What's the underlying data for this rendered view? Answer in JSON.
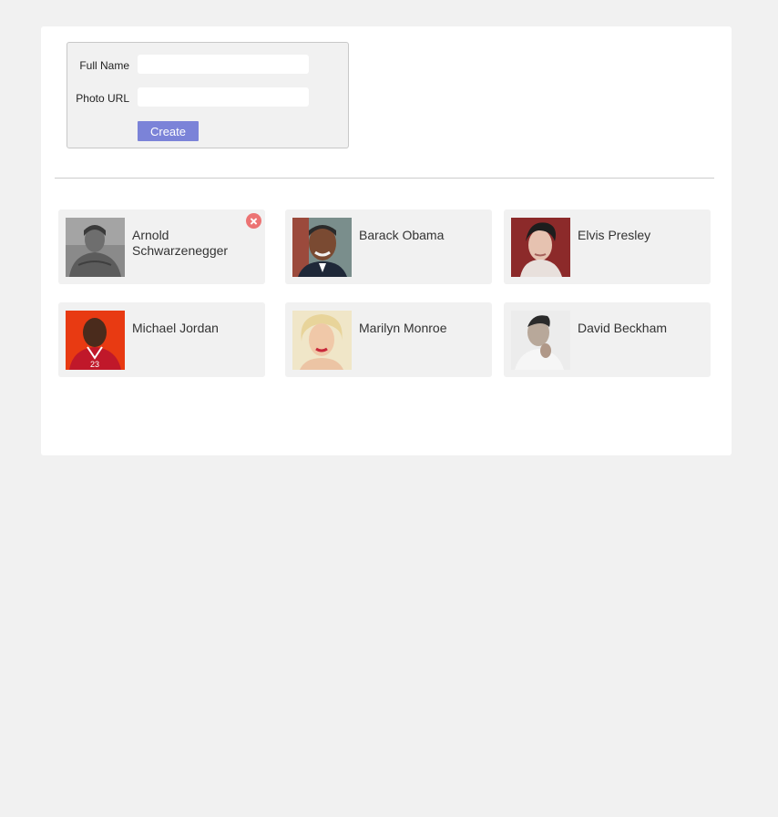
{
  "form": {
    "full_name_label": "Full Name",
    "full_name_value": "",
    "photo_url_label": "Photo URL",
    "photo_url_value": "",
    "create_label": "Create"
  },
  "people": [
    {
      "name": "Arnold Schwarzenegger",
      "photo": "arnold-photo"
    },
    {
      "name": "Barack Obama",
      "photo": "barack-photo"
    },
    {
      "name": "Elvis Presley",
      "photo": "elvis-photo"
    },
    {
      "name": "Michael Jordan",
      "photo": "michael-photo"
    },
    {
      "name": "Marilyn Monroe",
      "photo": "marilyn-photo"
    },
    {
      "name": "David Beckham",
      "photo": "david-photo"
    }
  ],
  "colors": {
    "button": "#7b83d8",
    "remove": "#ec7373",
    "card": "#f1f1f1"
  }
}
